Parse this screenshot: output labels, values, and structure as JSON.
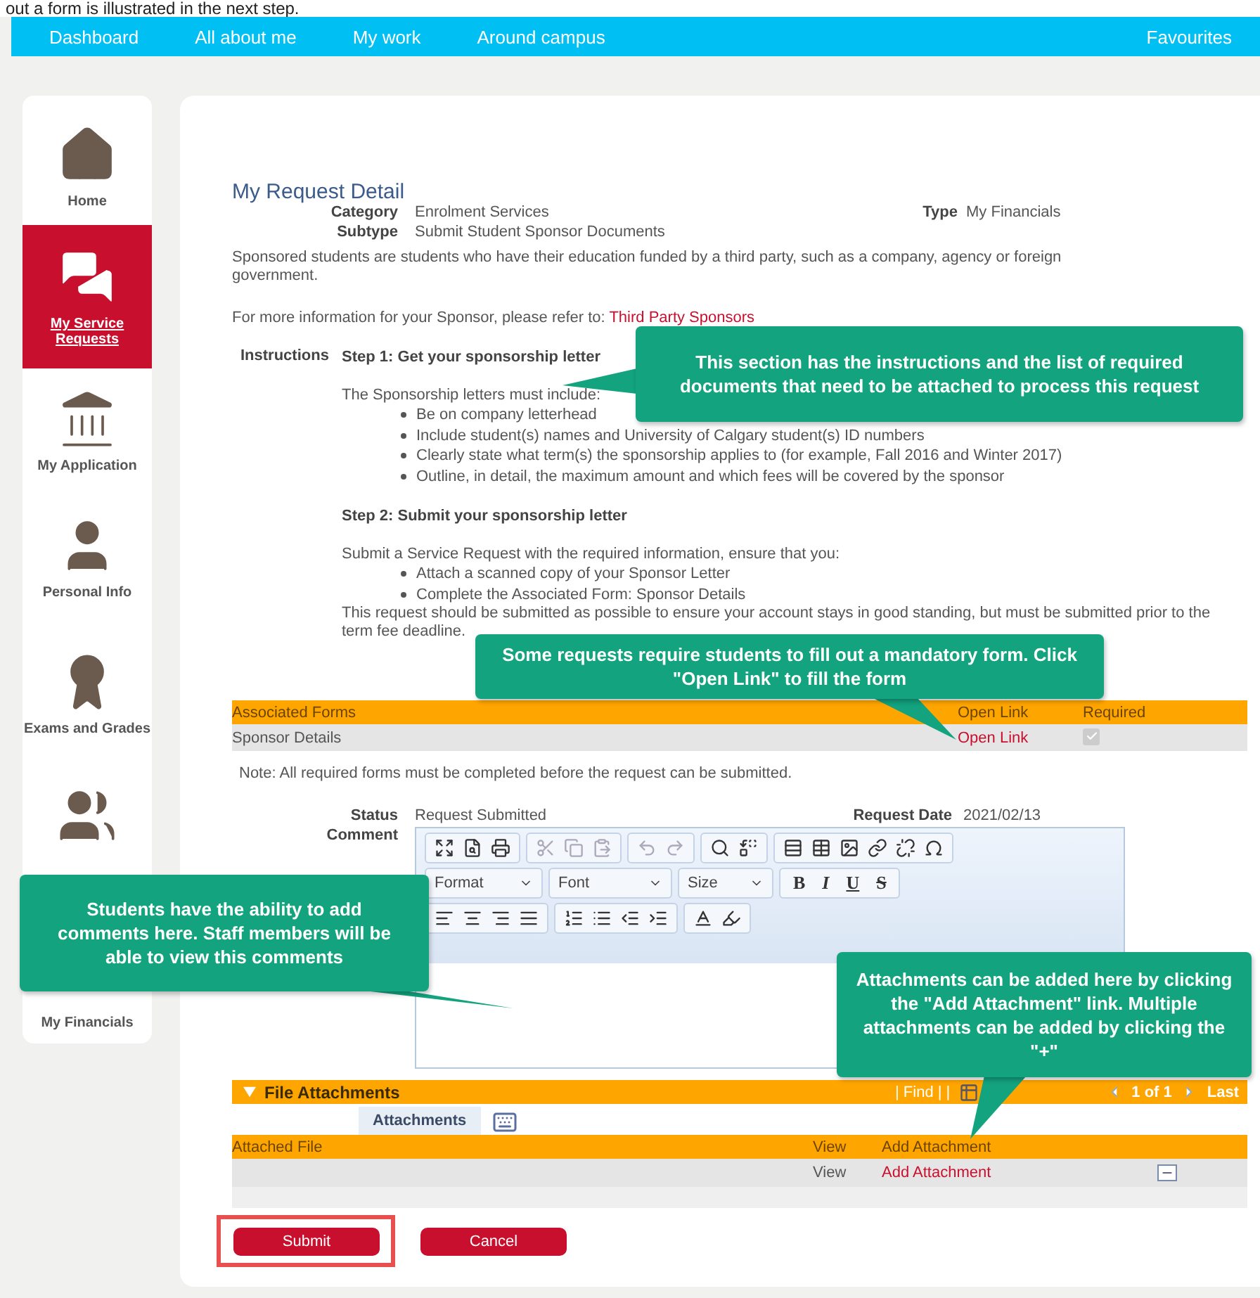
{
  "caption": "out a form is illustrated in the next step.",
  "nav": {
    "items": [
      "Dashboard",
      "All about me",
      "My work",
      "Around campus"
    ],
    "right": "Favourites"
  },
  "sidebar": {
    "items": [
      {
        "kind": "house",
        "label": "Home",
        "selected": false
      },
      {
        "kind": "chat",
        "label": "My Service Requests",
        "selected": true
      },
      {
        "kind": "bank",
        "label": "My Application",
        "selected": false
      },
      {
        "kind": "person",
        "label": "Personal Info",
        "selected": false
      },
      {
        "kind": "award",
        "label": "Exams and Grades",
        "selected": false
      },
      {
        "kind": "people",
        "selected": false
      },
      {
        "label": "My Financials",
        "selected": false
      }
    ]
  },
  "request": {
    "title": "My Request Detail",
    "fields": [
      {
        "label": "Category",
        "value": "Enrolment Services"
      },
      {
        "label": "Subtype",
        "value": "Submit Student Sponsor Documents"
      }
    ],
    "type": {
      "label": "Type",
      "value": "My Financials"
    },
    "intro": "Sponsored students are students who have their education funded by a third party, such as a company, agency or foreign government.",
    "sponsor_note": {
      "text": "For more information for your Sponsor, please refer to:",
      "link": "Third Party Sponsors"
    },
    "instructions": {
      "label": "Instructions",
      "steps": [
        {
          "heading": "Step 1: Get your sponsorship letter",
          "lead": "The Sponsorship letters must include:",
          "bullets": [
            "Be on company letterhead",
            "Include student(s) names and University of Calgary student(s) ID numbers",
            "Clearly state what term(s) the sponsorship applies to (for example, Fall 2016 and Winter 2017)",
            "Outline, in detail, the maximum amount and which fees will be covered by the sponsor"
          ]
        },
        {
          "heading": "Step 2: Submit your sponsorship letter",
          "lead": "Submit a Service Request with the required information, ensure that you:",
          "bullets": [
            "Attach a scanned copy of your Sponsor Letter",
            "Complete the Associated Form:  Sponsor Details"
          ],
          "after": "This request should be submitted as possible to ensure your account stays in good standing, but must be submitted prior to the term fee deadline."
        }
      ]
    }
  },
  "forms": {
    "columns": [
      "Associated Forms",
      "Open Link",
      "Required"
    ],
    "rows": [
      {
        "name": "Sponsor Details",
        "link": "Open Link",
        "checked": true
      }
    ],
    "note": "Note: All required forms must be completed before the request can be submitted."
  },
  "status": {
    "label": "Status",
    "value": "Request Submitted"
  },
  "request_date": {
    "label": "Request Date",
    "value": "2021/02/13"
  },
  "comment": {
    "label": "Comment",
    "dropdowns": [
      "Format",
      "Font",
      "Size"
    ],
    "styles": [
      "B",
      "I",
      "U",
      "S"
    ]
  },
  "attachments": {
    "title": "File Attachments",
    "expanded": true,
    "find": "| Find | |",
    "pager": "1 of 1",
    "last": "Last",
    "tab": "Attachments",
    "columns": [
      "Attached File",
      "View",
      "Add Attachment"
    ],
    "rows": [
      {
        "view": "View",
        "add": "Add Attachment"
      }
    ]
  },
  "buttons": [
    {
      "label": "Submit",
      "highlighted": true
    },
    {
      "label": "Cancel",
      "highlighted": false
    }
  ],
  "callouts": [
    "This section has the instructions and the list of required documents that need to be attached to process this request",
    "Some requests require students to fill out a mandatory form. Click \"Open Link\" to fill the form",
    "Students have the ability to add comments here. Staff members will be able to view this comments",
    "Attachments can be added here by clicking the \"Add Attachment\" link. Multiple attachments can be added by clicking the \"+\""
  ]
}
